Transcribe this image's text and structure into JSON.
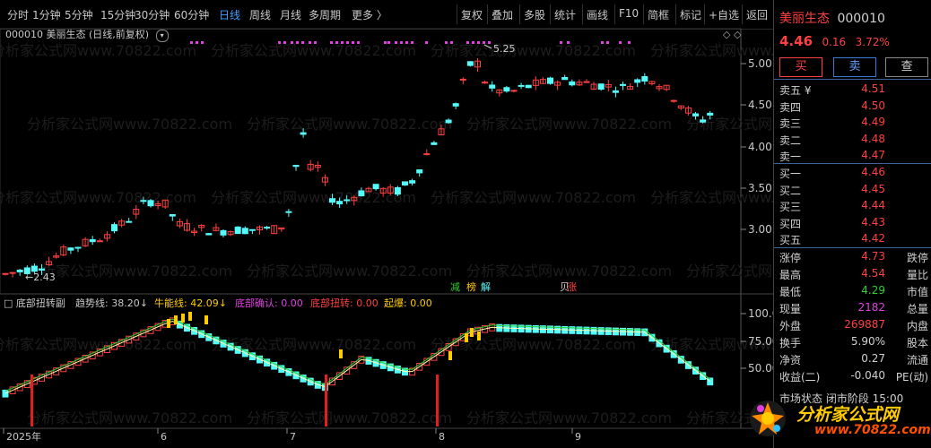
{
  "toolbar": {
    "left_items": [
      "分时",
      "1分钟",
      "5分钟",
      "15分钟",
      "30分钟",
      "60分钟",
      "日线",
      "周线",
      "月线",
      "多周期",
      "更多 〉"
    ],
    "active": "日线",
    "right_items": [
      "复权",
      "叠加",
      "多股",
      "统计",
      "画线",
      "F10",
      "简框",
      "标记",
      "+自选",
      "返回"
    ]
  },
  "stock": {
    "code": "000010",
    "name": "美丽生态",
    "chart_title": "000010  美丽生态 (日线,前复权)",
    "price": "4.46",
    "change": "0.16",
    "change_pct": "3.72%"
  },
  "main_chart": {
    "y_ticks": [
      "5.00",
      "4.50",
      "4.00",
      "3.50",
      "3.00"
    ],
    "high_label": "5.25",
    "low_label": "2.43",
    "signal_labels": [
      "减",
      "榜",
      "解",
      "贝",
      "涨"
    ]
  },
  "indicator": {
    "name": "底部扭转副",
    "trend_label": "趋势线: 38.20",
    "bull_label": "牛能线: 42.09",
    "confirm_label": "底部确认: 0.00",
    "twist_label": "底部扭转: 0.00",
    "burst_label": "起爆: 0.00",
    "y_ticks": [
      "100.0",
      "75.00",
      "50.00"
    ]
  },
  "date_axis": [
    "2025年",
    "6",
    "7",
    "8",
    "9"
  ],
  "watermark": "分析家公式网www.70822.com",
  "quote_panel": {
    "buy_label": "买",
    "sell_label": "卖",
    "query_label": "查",
    "asks": [
      {
        "label": "卖五 ¥",
        "price": "4.51"
      },
      {
        "label": "卖四",
        "price": "4.50"
      },
      {
        "label": "卖三",
        "price": "4.49"
      },
      {
        "label": "卖二",
        "price": "4.48"
      },
      {
        "label": "卖一",
        "price": "4.47"
      }
    ],
    "bids": [
      {
        "label": "买一",
        "price": "4.46"
      },
      {
        "label": "买二",
        "price": "4.45"
      },
      {
        "label": "买三",
        "price": "4.44"
      },
      {
        "label": "买四",
        "price": "4.43"
      },
      {
        "label": "买五",
        "price": "4.42"
      }
    ],
    "stats": [
      {
        "l": "涨停",
        "v": "4.73",
        "r": "跌停",
        "c": "#ff4040"
      },
      {
        "l": "最高",
        "v": "4.54",
        "r": "量比",
        "c": "#ff4040"
      },
      {
        "l": "最低",
        "v": "4.29",
        "r": "市值",
        "c": "#30d030"
      },
      {
        "l": "现量",
        "v": "2182",
        "r": "总量",
        "c": "#e040e0"
      },
      {
        "l": "外盘",
        "v": "269887",
        "r": "内盘",
        "c": "#ff4040"
      },
      {
        "l": "换手",
        "v": "5.90%",
        "r": "股本",
        "c": "#d0d0d0"
      },
      {
        "l": "净资",
        "v": "0.27",
        "r": "流通",
        "c": "#d0d0d0"
      },
      {
        "l": "收益(二)",
        "v": "-0.040",
        "r": "PE(动)",
        "c": "#d0d0d0"
      }
    ],
    "footer_partial": "市场状态  闭市阶段  15:00"
  },
  "logo": {
    "text": "分析家公式网",
    "url": "www.70822.com"
  }
}
